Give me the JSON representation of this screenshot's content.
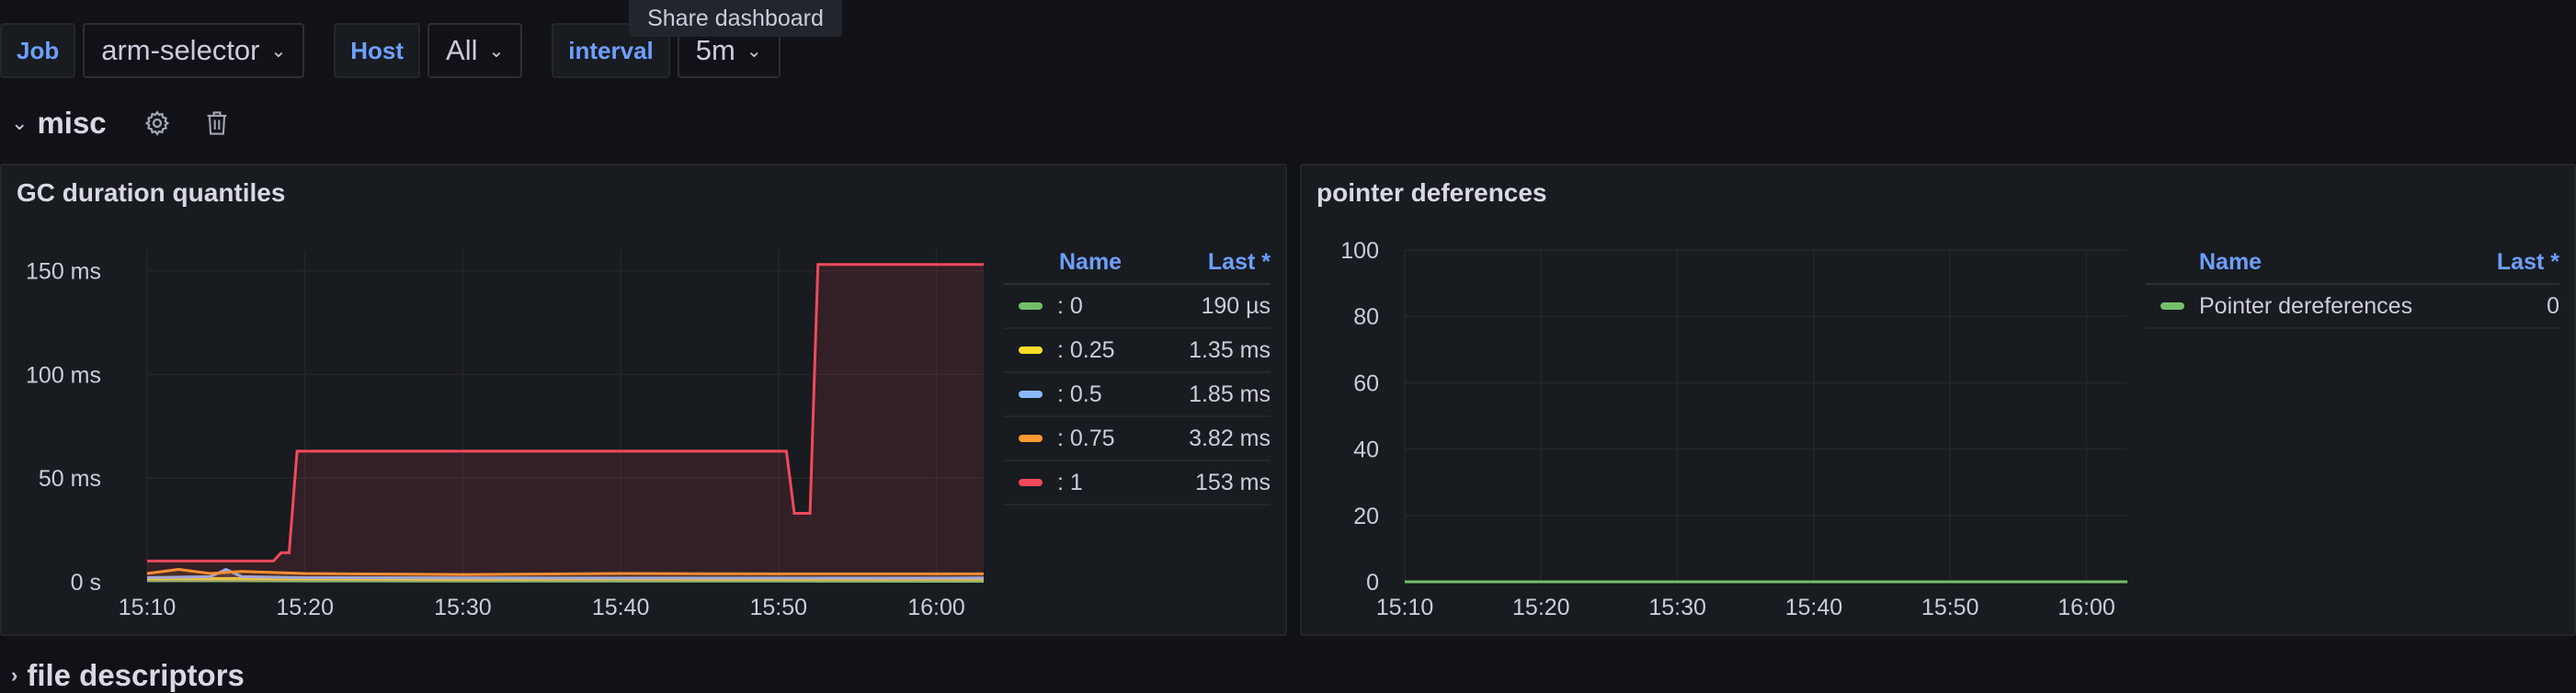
{
  "variables": [
    {
      "label": "Job",
      "value": "arm-selector"
    },
    {
      "label": "Host",
      "value": "All"
    },
    {
      "label": "interval",
      "value": "5m"
    }
  ],
  "tooltip": "Share dashboard",
  "row": {
    "title": "misc",
    "settings_icon": "gear-icon",
    "delete_icon": "trash-icon"
  },
  "next_row": {
    "title": "file descriptors"
  },
  "panels": [
    {
      "title": "GC duration quantiles",
      "legend": {
        "name_header": "Name",
        "last_header": "Last *",
        "items": [
          {
            "name": ": 0",
            "last": "190 µs",
            "color": "#73bf69"
          },
          {
            "name": ": 0.25",
            "last": "1.35 ms",
            "color": "#fade2a"
          },
          {
            "name": ": 0.5",
            "last": "1.85 ms",
            "color": "#8ab8ff"
          },
          {
            "name": ": 0.75",
            "last": "3.82 ms",
            "color": "#ff9830"
          },
          {
            "name": ": 1",
            "last": "153 ms",
            "color": "#f2495c"
          }
        ]
      }
    },
    {
      "title": "pointer deferences",
      "legend": {
        "name_header": "Name",
        "last_header": "Last *",
        "items": [
          {
            "name": "Pointer dereferences",
            "last": "0",
            "color": "#73bf69"
          }
        ]
      }
    }
  ],
  "chart_data": [
    {
      "type": "line",
      "title": "GC duration quantiles",
      "y_unit": "ms",
      "ylim": [
        0,
        160
      ],
      "yticks": [
        "0 s",
        "50 ms",
        "100 ms",
        "150 ms"
      ],
      "ytick_values": [
        0,
        50,
        100,
        150
      ],
      "xticks": [
        "15:10",
        "15:20",
        "15:30",
        "15:40",
        "15:50",
        "16:00"
      ],
      "xlim": [
        "15:10",
        "16:03"
      ],
      "grid": true,
      "legend_position": "right",
      "series": [
        {
          "name": ": 0",
          "color": "#73bf69",
          "x": [
            "15:10",
            "15:16",
            "15:20",
            "15:30",
            "15:40",
            "15:50",
            "16:03"
          ],
          "y": [
            0.5,
            0.5,
            0.4,
            0.3,
            0.3,
            0.3,
            0.2
          ]
        },
        {
          "name": ": 0.25",
          "color": "#fade2a",
          "x": [
            "15:10",
            "15:16",
            "15:20",
            "15:30",
            "15:40",
            "15:50",
            "16:03"
          ],
          "y": [
            1.5,
            1.6,
            1.4,
            1.3,
            1.4,
            1.3,
            1.35
          ]
        },
        {
          "name": ": 0.5",
          "color": "#8ab8ff",
          "x": [
            "15:10",
            "15:14",
            "15:15",
            "15:16",
            "15:20",
            "15:30",
            "15:40",
            "15:50",
            "16:03"
          ],
          "y": [
            2,
            2.5,
            6,
            2.5,
            2,
            1.9,
            1.8,
            1.8,
            1.85
          ]
        },
        {
          "name": ": 0.75",
          "color": "#ff9830",
          "x": [
            "15:10",
            "15:12",
            "15:14",
            "15:16",
            "15:20",
            "15:30",
            "15:40",
            "15:50",
            "16:03"
          ],
          "y": [
            4,
            6,
            4,
            5,
            4,
            3.5,
            4,
            3.8,
            3.82
          ]
        },
        {
          "name": ": 1",
          "color": "#f2495c",
          "x": [
            "15:10",
            "15:18",
            "15:18:30",
            "15:19",
            "15:19:30",
            "15:50",
            "15:50:30",
            "15:51",
            "15:52",
            "15:52:30",
            "16:03"
          ],
          "y": [
            10,
            10,
            14,
            14,
            63,
            63,
            63,
            33,
            33,
            153,
            153
          ]
        }
      ]
    },
    {
      "type": "line",
      "title": "pointer deferences",
      "ylim": [
        0,
        100
      ],
      "yticks": [
        "0",
        "20",
        "40",
        "60",
        "80",
        "100"
      ],
      "ytick_values": [
        0,
        20,
        40,
        60,
        80,
        100
      ],
      "xticks": [
        "15:10",
        "15:20",
        "15:30",
        "15:40",
        "15:50",
        "16:00"
      ],
      "xlim": [
        "15:10",
        "16:03"
      ],
      "grid": true,
      "legend_position": "right",
      "series": [
        {
          "name": "Pointer dereferences",
          "color": "#73bf69",
          "x": [
            "15:10",
            "16:03"
          ],
          "y": [
            0,
            0
          ]
        }
      ]
    }
  ]
}
